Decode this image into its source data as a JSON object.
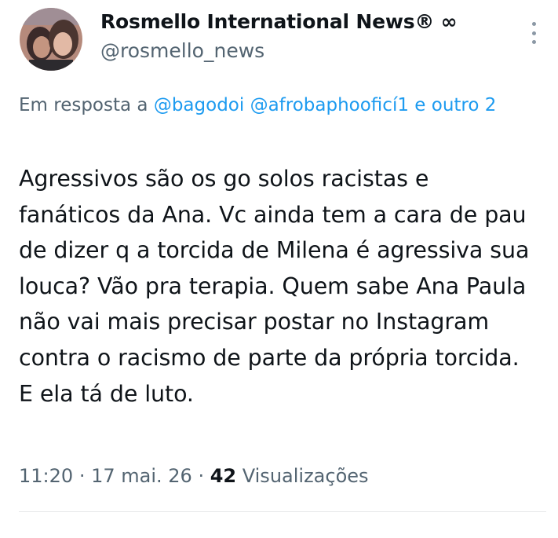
{
  "author": {
    "name": "Rosmello International News® ∞",
    "handle": "@rosmello_news"
  },
  "reply": {
    "prefix": "Em resposta a",
    "mention1": "@bagodoi",
    "mention2": "@afrobaphooficí1",
    "suffix": "e outro 2"
  },
  "tweet": {
    "text": "Agressivos são os go solos racistas e fanáticos da Ana. Vc ainda tem a cara de pau de dizer q a torcida de Milena é agressiva sua louca? Vão pra terapia. Quem sabe Ana Paula não vai mais precisar postar no Instagram contra o racismo de parte da própria torcida. E ela tá de luto."
  },
  "meta": {
    "time": "11:20",
    "date": "17 mai. 26",
    "views_count": "42",
    "views_label": "Visualizações"
  }
}
